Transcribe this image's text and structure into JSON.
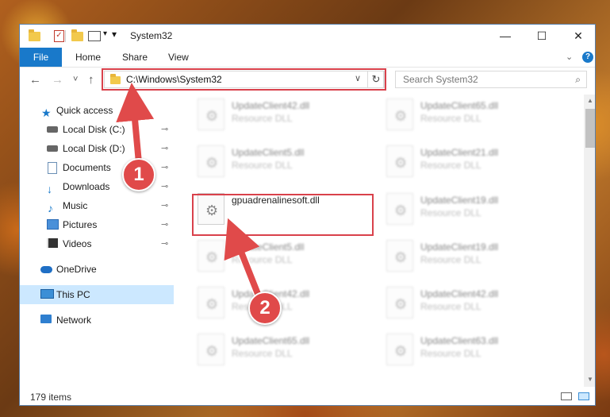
{
  "window": {
    "title": "System32",
    "min_glyph": "—",
    "max_glyph": "☐",
    "close_glyph": "✕"
  },
  "ribbon": {
    "tabs": [
      "File",
      "Home",
      "Share",
      "View"
    ],
    "expand_glyph": "⌄",
    "help_glyph": "?"
  },
  "nav": {
    "back_glyph": "←",
    "forward_glyph": "→",
    "recent_glyph": "˅",
    "up_glyph": "↑",
    "address": "C:\\Windows\\System32",
    "address_dropdown_glyph": "∨",
    "refresh_glyph": "↻",
    "search_placeholder": "Search System32",
    "search_glyph": "⌕"
  },
  "sidebar": {
    "pin_glyph": "📌",
    "items": [
      {
        "label": "Quick access"
      },
      {
        "label": "Local Disk (C:)"
      },
      {
        "label": "Local Disk (D:)"
      },
      {
        "label": "Documents"
      },
      {
        "label": "Downloads"
      },
      {
        "label": "Music"
      },
      {
        "label": "Pictures"
      },
      {
        "label": "Videos"
      },
      {
        "label": "OneDrive"
      },
      {
        "label": "This PC"
      },
      {
        "label": "Network"
      }
    ]
  },
  "files": {
    "gear_glyph": "⚙",
    "left": [
      {
        "name": "UpdateClient42.dll",
        "type": "Resource DLL"
      },
      {
        "name": "UpdateClient5.dll",
        "type": "Resource DLL"
      },
      {
        "name": "gpuadrenalinesoft.dll",
        "type": ""
      },
      {
        "name": "UpdateClient5.dll",
        "type": "Resource DLL"
      },
      {
        "name": "UpdateClient42.dll",
        "type": "Resource DLL"
      },
      {
        "name": "UpdateClient65.dll",
        "type": "Resource DLL"
      }
    ],
    "right": [
      {
        "name": "UpdateClient65.dll",
        "type": "Resource DLL"
      },
      {
        "name": "UpdateClient21.dll",
        "type": "Resource DLL"
      },
      {
        "name": "UpdateClient19.dll",
        "type": "Resource DLL"
      },
      {
        "name": "UpdateClient19.dll",
        "type": "Resource DLL"
      },
      {
        "name": "UpdateClient42.dll",
        "type": "Resource DLL"
      },
      {
        "name": "UpdateClient63.dll",
        "type": "Resource DLL"
      }
    ]
  },
  "scrollbar": {
    "up_glyph": "▲",
    "down_glyph": "▼"
  },
  "status": {
    "item_count": "179 items"
  },
  "annotations": {
    "step1": "1",
    "step2": "2"
  },
  "colors": {
    "accent": "#1979ca",
    "highlight": "#d9414b",
    "selected": "#cce8ff"
  }
}
